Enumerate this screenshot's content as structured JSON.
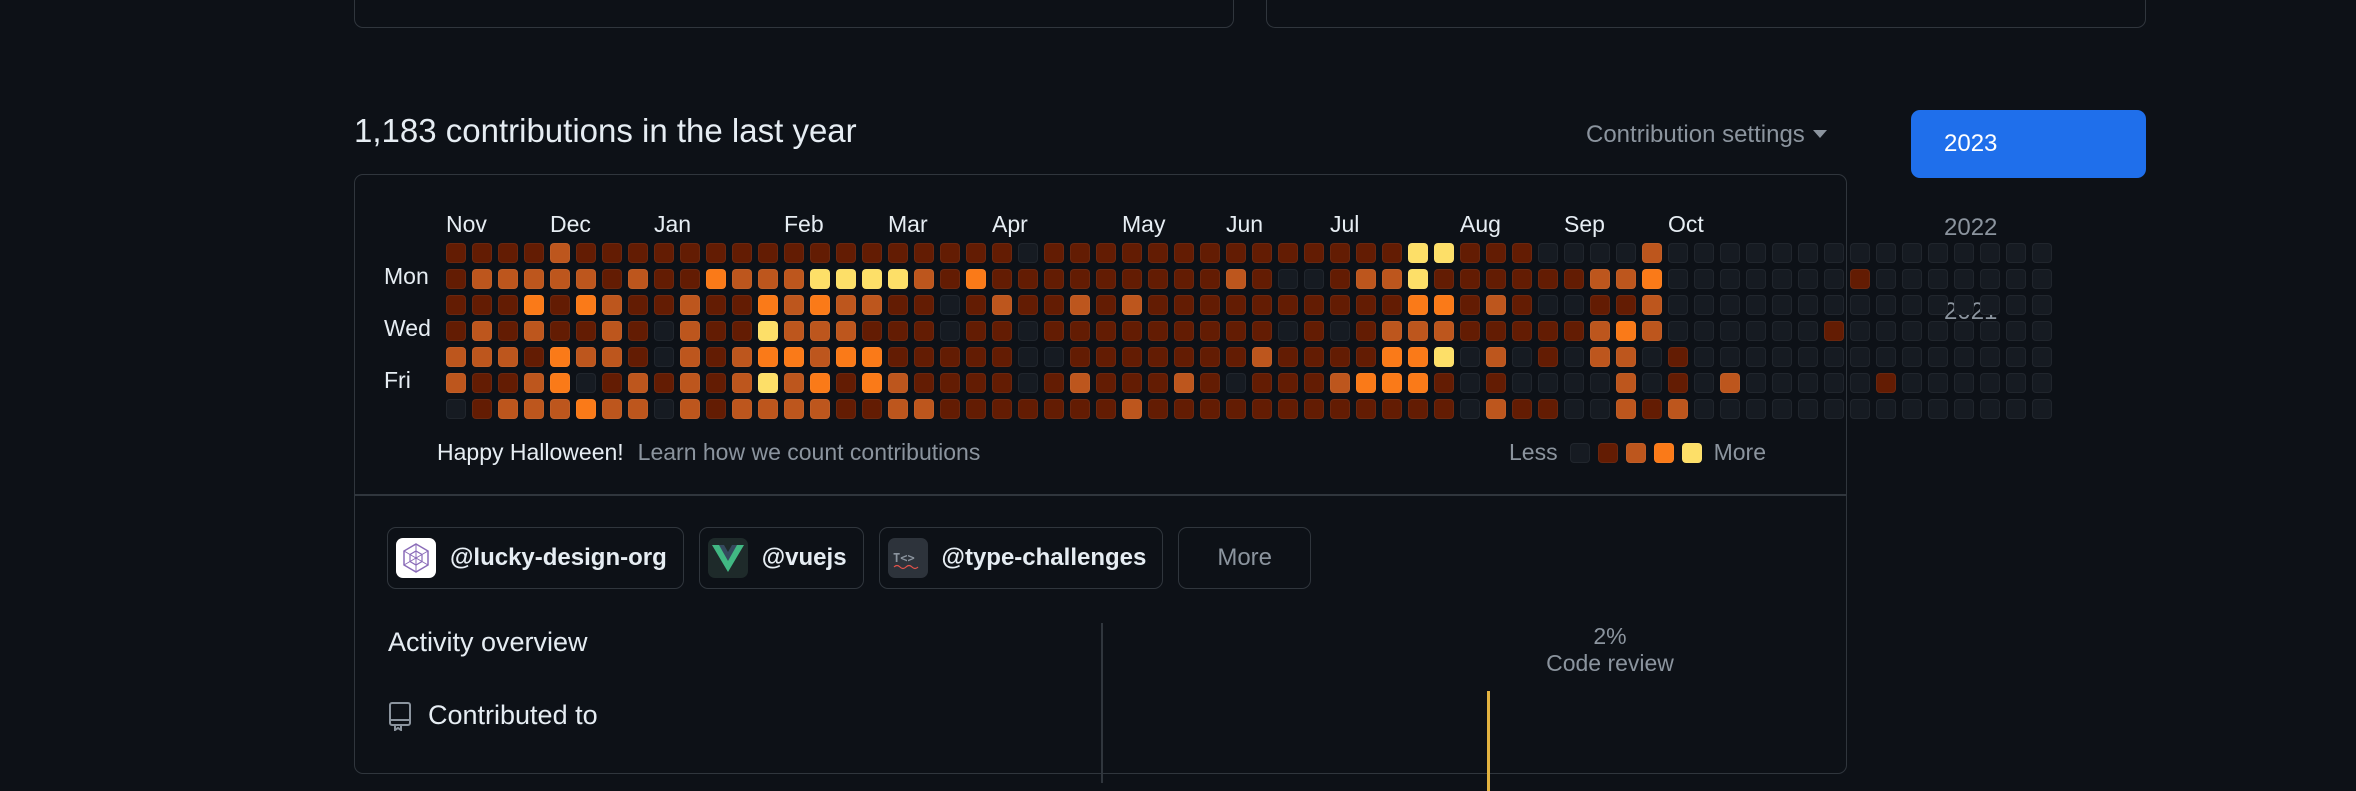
{
  "headline": "1,183 contributions in the last year",
  "settings_label": "Contribution settings",
  "years": [
    "2023",
    "2022",
    "2021"
  ],
  "active_year": "2023",
  "months": [
    "Nov",
    "Dec",
    "Jan",
    "Feb",
    "Mar",
    "Apr",
    "May",
    "Jun",
    "Jul",
    "Aug",
    "Sep",
    "Oct"
  ],
  "day_labels": [
    "Mon",
    "Wed",
    "Fri"
  ],
  "footer": {
    "greeting": "Happy Halloween!",
    "learn": "Learn how we count contributions",
    "less": "Less",
    "more": "More"
  },
  "level_colors": [
    "#161b22",
    "#631c03",
    "#bd561d",
    "#fa7a18",
    "#fddf68"
  ],
  "contribution_weeks": [
    "1111220",
    "1212211",
    "1211212",
    "1232122",
    "2211332",
    "1231203",
    "1122212",
    "1211122",
    "1110010",
    "1122222",
    "1311111",
    "1211222",
    "1234342",
    "1222322",
    "1432232",
    "1422311",
    "1421331",
    "1411122",
    "1211112",
    "1100111",
    "1311111",
    "1121111",
    "0110001",
    "1111011",
    "1121121",
    "1111111",
    "1121112",
    "1111111",
    "1111121",
    "1111111",
    "1211101",
    "1111211",
    "1010111",
    "1011111",
    "1110121",
    "1211131",
    "1212331",
    "4432331",
    "4132411",
    "1111000",
    "1121212",
    "1111001",
    "0101101",
    "0101000",
    "0212200",
    "0213222",
    "2322001",
    "0000112",
    "0000000",
    "0000020",
    "0000000",
    "0000000",
    "0000000",
    "0001000",
    "0100000",
    "0000010",
    "0000000",
    "0000000",
    "0000000",
    "0000000",
    "0000000",
    "0000000"
  ],
  "orgs": [
    {
      "handle": "@lucky-design-org",
      "icon": "lucky-design-org-avatar"
    },
    {
      "handle": "@vuejs",
      "icon": "vuejs-logo"
    },
    {
      "handle": "@type-challenges",
      "icon": "type-challenges-logo"
    }
  ],
  "orgs_more": "More",
  "activity_overview": {
    "title": "Activity overview",
    "contributed_to": "Contributed to",
    "code_review_pct": "2%",
    "code_review_label": "Code review"
  }
}
